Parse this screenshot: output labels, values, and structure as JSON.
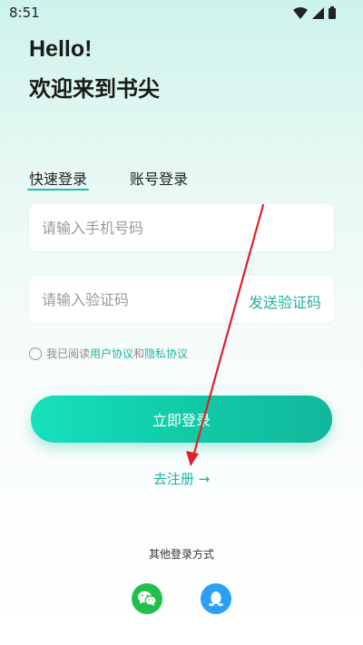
{
  "status_bar": {
    "time": "8:51",
    "icons": [
      "wifi-icon",
      "signal-icon",
      "battery-icon"
    ]
  },
  "header": {
    "hello": "Hello!",
    "welcome": "欢迎来到书尖"
  },
  "tabs": [
    {
      "label": "快速登录",
      "active": true
    },
    {
      "label": "账号登录",
      "active": false
    }
  ],
  "phone_input": {
    "placeholder": "请输入手机号码",
    "value": ""
  },
  "code_input": {
    "placeholder": "请输入验证码",
    "value": ""
  },
  "send_code_label": "发送验证码",
  "agreement": {
    "prefix": "我已阅读",
    "user_agreement": "用户协议",
    "conjunction": "和",
    "privacy_agreement": "隐私协议",
    "checked": false
  },
  "login_button_label": "立即登录",
  "register_label": "去注册 →",
  "other_login_label": "其他登录方式",
  "social": [
    {
      "name": "wechat-icon",
      "color": "#21c04c"
    },
    {
      "name": "qq-icon",
      "color": "#2aa0f5"
    }
  ],
  "colors": {
    "accent": "#1fb59a",
    "annotation_arrow": "#e0202a"
  }
}
